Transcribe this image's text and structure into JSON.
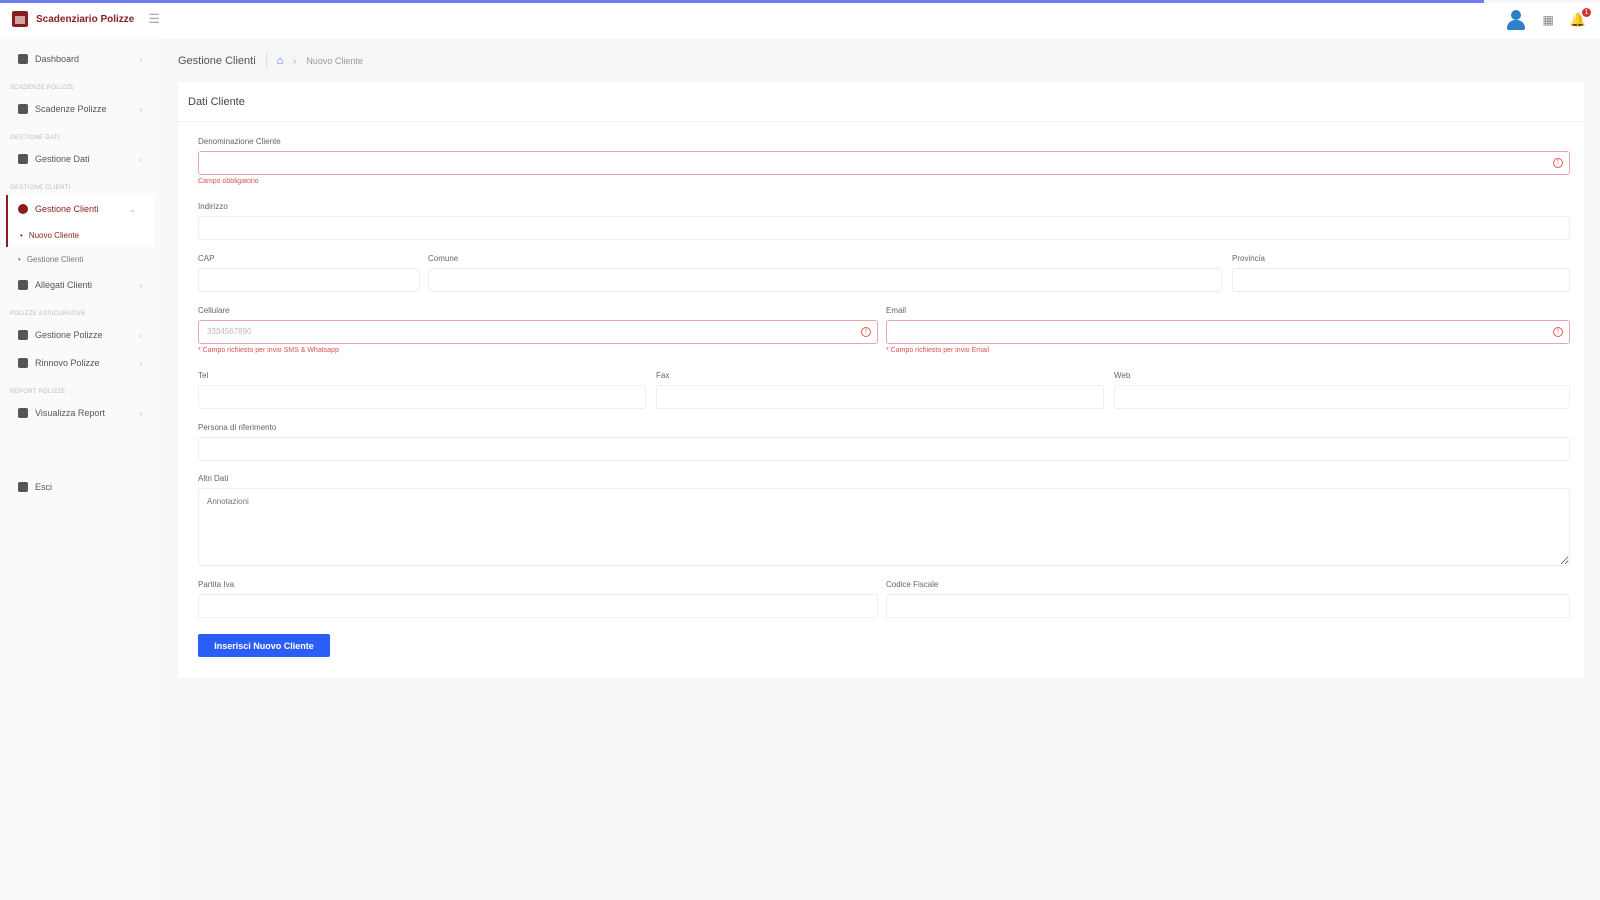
{
  "app": {
    "brand_name": "Scadenziario Polizze"
  },
  "topbar": {
    "notifications_count": "1"
  },
  "sidebar": {
    "items": [
      {
        "type": "item",
        "label": "Dashboard"
      },
      {
        "type": "section",
        "label": "SCADENZE POLIZZE"
      },
      {
        "type": "item",
        "label": "Scadenze Polizze"
      },
      {
        "type": "section",
        "label": "GESTIONE DATI"
      },
      {
        "type": "item",
        "label": "Gestione Dati"
      },
      {
        "type": "section",
        "label": "GESTIONE CLIENTI"
      },
      {
        "type": "item",
        "label": "Gestione Clienti",
        "active": true
      },
      {
        "type": "sub",
        "label": "Nuovo Cliente",
        "active": true
      },
      {
        "type": "sub",
        "label": "Gestione Clienti"
      },
      {
        "type": "item",
        "label": "Allegati Clienti"
      },
      {
        "type": "section",
        "label": "POLIZZE ASSICURATIVE"
      },
      {
        "type": "item",
        "label": "Gestione Polizze"
      },
      {
        "type": "item",
        "label": "Rinnovo Polizze"
      },
      {
        "type": "section",
        "label": "REPORT POLIZZE"
      },
      {
        "type": "item",
        "label": "Visualizza Report"
      }
    ],
    "exit_label": "Esci"
  },
  "breadcrumb": {
    "title": "Gestione Clienti",
    "current": "Nuovo Cliente"
  },
  "card": {
    "title": "Dati Cliente"
  },
  "form": {
    "denominazione": {
      "label": "Denominazione Cliente",
      "error": "Campo obbligatorio"
    },
    "indirizzo": {
      "label": "Indirizzo"
    },
    "cap": {
      "label": "CAP"
    },
    "comune": {
      "label": "Comune"
    },
    "provincia": {
      "label": "Provincia"
    },
    "cellulare": {
      "label": "Cellulare",
      "placeholder": "3334567890",
      "error": "* Campo richiesto per invio SMS & Whatsapp"
    },
    "email": {
      "label": "Email",
      "error": "* Campo richiesto per invio Email"
    },
    "tel": {
      "label": "Tel"
    },
    "fax": {
      "label": "Fax"
    },
    "web": {
      "label": "Web"
    },
    "persona": {
      "label": "Persona di riferimento"
    },
    "altri_dati": {
      "label": "Altri Dati",
      "placeholder": "Annotazioni"
    },
    "partita_iva": {
      "label": "Partita Iva"
    },
    "codice_fiscale": {
      "label": "Codice Fiscale"
    },
    "submit_label": "Inserisci Nuovo Cliente"
  }
}
